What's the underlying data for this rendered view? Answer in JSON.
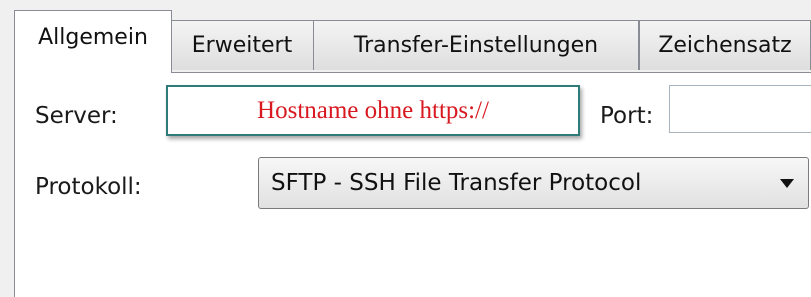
{
  "tabs": [
    {
      "label": "Allgemein",
      "active": true
    },
    {
      "label": "Erweitert",
      "active": false
    },
    {
      "label": "Transfer-Einstellungen",
      "active": false
    },
    {
      "label": "Zeichensatz",
      "active": false
    }
  ],
  "form": {
    "server_label": "Server:",
    "server_hint": "Hostname ohne https://",
    "port_label": "Port:",
    "port_value": "",
    "protocol_label": "Protokoll:",
    "protocol_value": "SFTP - SSH File Transfer Protocol"
  },
  "colors": {
    "hint_text": "#d81920",
    "hint_border": "#2f7b7a"
  },
  "icons": {
    "dropdown": "chevron-down-icon"
  }
}
